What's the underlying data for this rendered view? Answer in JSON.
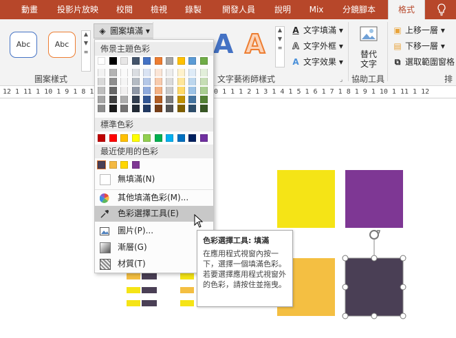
{
  "tabs": [
    {
      "label": "動畫",
      "left": 0
    },
    {
      "label": "投影片放映"
    },
    {
      "label": "校閱"
    },
    {
      "label": "檢視"
    },
    {
      "label": "錄製"
    },
    {
      "label": "開發人員"
    },
    {
      "label": "說明"
    },
    {
      "label": "Mix"
    },
    {
      "label": "分鏡腳本"
    },
    {
      "label": "格式"
    },
    {
      "label": ""
    }
  ],
  "ribbon": {
    "shape_styles_group": "圖案樣式",
    "shape_style_sample": "Abc",
    "shape_fill_button": "圖案填滿",
    "wordart_group": "文字藝術師樣式",
    "text_fill": "文字填滿",
    "text_outline": "文字外框",
    "text_effects": "文字效果",
    "accessibility_group": "協助工具",
    "alt_text": "替代\n文字",
    "bring_forward": "上移一層",
    "send_backward": "下移一層",
    "selection_pane": "選取範圍窗格",
    "arrange_group": "排"
  },
  "ruler": "12 1 11 1 10 1 9 1 8 1 7 1 6 1 5 1 4 1 3 1 2 1 1 1 0 1 1 1 2 1 3 1 4 1 5 1 6 1 7 1 8 1 9 1 10 1 11 1 12",
  "menu": {
    "theme_colors_header": "佈景主題色彩",
    "standard_colors_header": "標準色彩",
    "recent_colors_header": "最近使用的色彩",
    "no_fill": "無填滿(N)",
    "more_colors": "其他填滿色彩(M)...",
    "eyedropper": "色彩選擇工具(E)",
    "picture": "圖片(P)...",
    "gradient": "漸層(G)",
    "texture": "材質(T)",
    "theme_row": [
      "#ffffff",
      "#000000",
      "#e7e6e6",
      "#44546a",
      "#4472c4",
      "#ed7d31",
      "#a5a5a5",
      "#ffc000",
      "#5b9bd5",
      "#70ad47"
    ],
    "standard_row": [
      "#c00000",
      "#ff0000",
      "#ffc000",
      "#ffff00",
      "#92d050",
      "#00b050",
      "#00b0f0",
      "#0070c0",
      "#002060",
      "#7030a0"
    ],
    "recent_row": [
      "#4a3f55",
      "#f4b942",
      "#ffd700",
      "#7e3794"
    ]
  },
  "tooltip": {
    "title": "色彩選擇工具: 填滿",
    "body": "在應用程式視窗內按一下，選擇一個填滿色彩。若要選擇應用程式視窗外的色彩，請按住並拖曳。"
  },
  "colors": {
    "accent": "#b7472a",
    "yellow": "#f5e416",
    "purple": "#7e3794",
    "orange_yellow": "#f4bf42",
    "dark": "#4a3f55"
  }
}
